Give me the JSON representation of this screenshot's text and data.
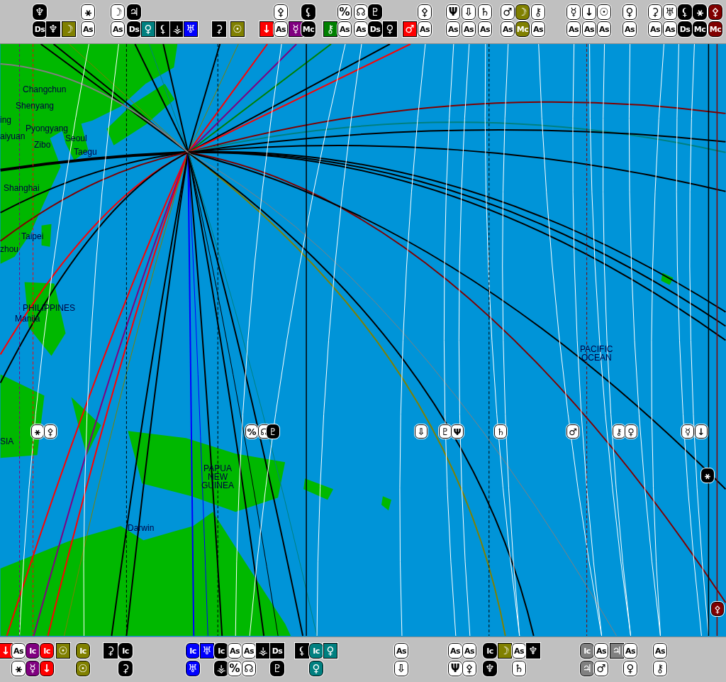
{
  "top_bar": {
    "upper_markers": [
      {
        "symbol": "♆",
        "color": "#000000",
        "kind": "round"
      },
      {
        "symbol": "⚹",
        "color": "#ffffff",
        "kind": "round"
      },
      {
        "symbol": "☽",
        "color": "#ffffff",
        "kind": "round"
      },
      {
        "symbol": "♃",
        "color": "#000000",
        "kind": "round"
      },
      {
        "symbol": "⚴",
        "color": "#ffffff",
        "kind": "round"
      },
      {
        "symbol": "⚸",
        "color": "#000000",
        "kind": "round"
      },
      {
        "symbol": "%",
        "color": "#ffffff",
        "kind": "round"
      },
      {
        "symbol": "☊",
        "color": "#ffffff",
        "kind": "round"
      },
      {
        "symbol": "♇",
        "color": "#000000",
        "kind": "round"
      },
      {
        "symbol": "⚴",
        "color": "#ffffff",
        "kind": "round"
      },
      {
        "symbol": "Ψ",
        "color": "#ffffff",
        "kind": "round"
      },
      {
        "symbol": "⇩",
        "color": "#ffffff",
        "kind": "round"
      },
      {
        "symbol": "♄",
        "color": "#ffffff",
        "kind": "round"
      },
      {
        "symbol": "♂",
        "color": "#ffffff",
        "kind": "round"
      },
      {
        "symbol": "☽",
        "color": "#808000",
        "kind": "round"
      },
      {
        "symbol": "⚷",
        "color": "#ffffff",
        "kind": "round"
      },
      {
        "symbol": "☿",
        "color": "#ffffff",
        "kind": "round"
      },
      {
        "symbol": "↓",
        "color": "#ffffff",
        "kind": "round"
      },
      {
        "symbol": "☉",
        "color": "#ffffff",
        "kind": "round"
      },
      {
        "symbol": "♀",
        "color": "#ffffff",
        "kind": "round"
      },
      {
        "symbol": "⚳",
        "color": "#ffffff",
        "kind": "round"
      },
      {
        "symbol": "♅",
        "color": "#ffffff",
        "kind": "round"
      },
      {
        "symbol": "⚸",
        "color": "#000000",
        "kind": "round"
      },
      {
        "symbol": "⚹",
        "color": "#000000",
        "kind": "round"
      },
      {
        "symbol": "⚴",
        "color": "#800000",
        "kind": "round"
      }
    ],
    "lower_markers": [
      {
        "symbol": "Ds",
        "color": "#000000",
        "kind": "round"
      },
      {
        "symbol": "♆",
        "color": "#000000",
        "kind": "square"
      },
      {
        "symbol": "☽",
        "color": "#808000",
        "kind": "square"
      },
      {
        "symbol": "As",
        "color": "#ffffff",
        "kind": "round"
      },
      {
        "symbol": "As",
        "color": "#ffffff",
        "kind": "round"
      },
      {
        "symbol": "Ds",
        "color": "#000000",
        "kind": "round"
      },
      {
        "symbol": "♀",
        "color": "#008080",
        "kind": "square"
      },
      {
        "symbol": "⚸",
        "color": "#000000",
        "kind": "square"
      },
      {
        "symbol": "⚶",
        "color": "#000000",
        "kind": "square"
      },
      {
        "symbol": "♅",
        "color": "#0000ff",
        "kind": "square"
      },
      {
        "symbol": "⚳",
        "color": "#000000",
        "kind": "square"
      },
      {
        "symbol": "☉",
        "color": "#808000",
        "kind": "square"
      },
      {
        "symbol": "↓",
        "color": "#ff0000",
        "kind": "square"
      },
      {
        "symbol": "As",
        "color": "#ffffff",
        "kind": "round"
      },
      {
        "symbol": "☿",
        "color": "#800080",
        "kind": "square"
      },
      {
        "symbol": "Mc",
        "color": "#000000",
        "kind": "round"
      },
      {
        "symbol": "⚷",
        "color": "#008000",
        "kind": "square"
      },
      {
        "symbol": "As",
        "color": "#ffffff",
        "kind": "round"
      },
      {
        "symbol": "As",
        "color": "#ffffff",
        "kind": "round"
      },
      {
        "symbol": "Ds",
        "color": "#000000",
        "kind": "round"
      },
      {
        "symbol": "♀",
        "color": "#000000",
        "kind": "square"
      },
      {
        "symbol": "♂",
        "color": "#ff0000",
        "kind": "square"
      },
      {
        "symbol": "As",
        "color": "#ffffff",
        "kind": "round"
      },
      {
        "symbol": "As",
        "color": "#ffffff",
        "kind": "round"
      },
      {
        "symbol": "As",
        "color": "#ffffff",
        "kind": "round"
      },
      {
        "symbol": "As",
        "color": "#ffffff",
        "kind": "round"
      },
      {
        "symbol": "As",
        "color": "#ffffff",
        "kind": "round"
      },
      {
        "symbol": "Mc",
        "color": "#808000",
        "kind": "round"
      },
      {
        "symbol": "As",
        "color": "#ffffff",
        "kind": "round"
      },
      {
        "symbol": "As",
        "color": "#ffffff",
        "kind": "round"
      },
      {
        "symbol": "As",
        "color": "#ffffff",
        "kind": "round"
      },
      {
        "symbol": "As",
        "color": "#ffffff",
        "kind": "round"
      },
      {
        "symbol": "As",
        "color": "#ffffff",
        "kind": "round"
      },
      {
        "symbol": "As",
        "color": "#ffffff",
        "kind": "round"
      },
      {
        "symbol": "As",
        "color": "#ffffff",
        "kind": "round"
      },
      {
        "symbol": "Ds",
        "color": "#000000",
        "kind": "round"
      },
      {
        "symbol": "Mc",
        "color": "#000000",
        "kind": "round"
      },
      {
        "symbol": "Mc",
        "color": "#800000",
        "kind": "round"
      }
    ]
  },
  "map": {
    "places": [
      {
        "name": "Changchun"
      },
      {
        "name": "Shenyang"
      },
      {
        "name": "ing"
      },
      {
        "name": "Pyongyang"
      },
      {
        "name": "aiyuan"
      },
      {
        "name": "Seoul"
      },
      {
        "name": "Zibo"
      },
      {
        "name": "Taegu"
      },
      {
        "name": "Shanghai"
      },
      {
        "name": "Taipei"
      },
      {
        "name": "zhou"
      },
      {
        "name": "PHILIPPINES"
      },
      {
        "name": "Manila"
      },
      {
        "name": "SIA"
      },
      {
        "name": "PAPUA\nNEW\nGUINEA"
      },
      {
        "name": "Darwin"
      },
      {
        "name": "PACIFIC\nOCEAN"
      }
    ],
    "markers": [
      {
        "symbol": "⚹",
        "color": "#ffffff"
      },
      {
        "symbol": "⚴",
        "color": "#ffffff"
      },
      {
        "symbol": "%",
        "color": "#ffffff"
      },
      {
        "symbol": "☊",
        "color": "#ffffff"
      },
      {
        "symbol": "♇",
        "color": "#000000"
      },
      {
        "symbol": "⇩",
        "color": "#ffffff"
      },
      {
        "symbol": "♇",
        "color": "#ffffff"
      },
      {
        "symbol": "Ψ",
        "color": "#ffffff"
      },
      {
        "symbol": "♄",
        "color": "#ffffff"
      },
      {
        "symbol": "♂",
        "color": "#ffffff"
      },
      {
        "symbol": "⚷",
        "color": "#ffffff"
      },
      {
        "symbol": "♀",
        "color": "#ffffff"
      },
      {
        "symbol": "☿",
        "color": "#ffffff"
      },
      {
        "symbol": "↓",
        "color": "#ffffff"
      },
      {
        "symbol": "⚹",
        "color": "#000000"
      },
      {
        "symbol": "⚴",
        "color": "#800000"
      }
    ]
  },
  "bottom_bar": {
    "upper_markers": [
      {
        "symbol": "↓",
        "color": "#ff0000",
        "kind": "square"
      },
      {
        "symbol": "As",
        "color": "#ffffff",
        "kind": "round"
      },
      {
        "symbol": "Ic",
        "color": "#800080",
        "kind": "round"
      },
      {
        "symbol": "Ic",
        "color": "#ff0000",
        "kind": "round"
      },
      {
        "symbol": "☉",
        "color": "#808000",
        "kind": "square"
      },
      {
        "symbol": "Ic",
        "color": "#808000",
        "kind": "round"
      },
      {
        "symbol": "⚳",
        "color": "#000000",
        "kind": "square"
      },
      {
        "symbol": "Ic",
        "color": "#000000",
        "kind": "round"
      },
      {
        "symbol": "Ic",
        "color": "#0000ff",
        "kind": "round"
      },
      {
        "symbol": "♅",
        "color": "#0000ff",
        "kind": "square"
      },
      {
        "symbol": "Ic",
        "color": "#000000",
        "kind": "round"
      },
      {
        "symbol": "As",
        "color": "#ffffff",
        "kind": "round"
      },
      {
        "symbol": "As",
        "color": "#ffffff",
        "kind": "round"
      },
      {
        "symbol": "⚶",
        "color": "#000000",
        "kind": "square"
      },
      {
        "symbol": "Ds",
        "color": "#000000",
        "kind": "square"
      },
      {
        "symbol": "⚸",
        "color": "#000000",
        "kind": "square"
      },
      {
        "symbol": "Ic",
        "color": "#008080",
        "kind": "round"
      },
      {
        "symbol": "♀",
        "color": "#008080",
        "kind": "square"
      },
      {
        "symbol": "As",
        "color": "#ffffff",
        "kind": "round"
      },
      {
        "symbol": "As",
        "color": "#ffffff",
        "kind": "round"
      },
      {
        "symbol": "As",
        "color": "#ffffff",
        "kind": "round"
      },
      {
        "symbol": "Ic",
        "color": "#000000",
        "kind": "round"
      },
      {
        "symbol": "☽",
        "color": "#808000",
        "kind": "square"
      },
      {
        "symbol": "As",
        "color": "#ffffff",
        "kind": "round"
      },
      {
        "symbol": "♆",
        "color": "#000000",
        "kind": "square"
      },
      {
        "symbol": "Ic",
        "color": "#808080",
        "kind": "round"
      },
      {
        "symbol": "As",
        "color": "#ffffff",
        "kind": "round"
      },
      {
        "symbol": "♃",
        "color": "#808080",
        "kind": "square"
      },
      {
        "symbol": "As",
        "color": "#ffffff",
        "kind": "round"
      },
      {
        "symbol": "As",
        "color": "#ffffff",
        "kind": "round"
      }
    ],
    "lower_markers": [
      {
        "symbol": "⚹",
        "color": "#ffffff",
        "kind": "round"
      },
      {
        "symbol": "☿",
        "color": "#800080",
        "kind": "round"
      },
      {
        "symbol": "↓",
        "color": "#ff0000",
        "kind": "round"
      },
      {
        "symbol": "☉",
        "color": "#808000",
        "kind": "round"
      },
      {
        "symbol": "⚳",
        "color": "#000000",
        "kind": "round"
      },
      {
        "symbol": "♅",
        "color": "#0000ff",
        "kind": "round"
      },
      {
        "symbol": "⚶",
        "color": "#000000",
        "kind": "round"
      },
      {
        "symbol": "%",
        "color": "#ffffff",
        "kind": "round"
      },
      {
        "symbol": "☊",
        "color": "#ffffff",
        "kind": "round"
      },
      {
        "symbol": "♇",
        "color": "#000000",
        "kind": "round"
      },
      {
        "symbol": "♀",
        "color": "#008080",
        "kind": "round"
      },
      {
        "symbol": "⇩",
        "color": "#ffffff",
        "kind": "round"
      },
      {
        "symbol": "Ψ",
        "color": "#ffffff",
        "kind": "round"
      },
      {
        "symbol": "⚴",
        "color": "#ffffff",
        "kind": "round"
      },
      {
        "symbol": "♆",
        "color": "#000000",
        "kind": "round"
      },
      {
        "symbol": "♄",
        "color": "#ffffff",
        "kind": "round"
      },
      {
        "symbol": "♃",
        "color": "#808080",
        "kind": "round"
      },
      {
        "symbol": "♂",
        "color": "#ffffff",
        "kind": "round"
      },
      {
        "symbol": "♀",
        "color": "#ffffff",
        "kind": "round"
      },
      {
        "symbol": "⚷",
        "color": "#ffffff",
        "kind": "round"
      }
    ]
  }
}
